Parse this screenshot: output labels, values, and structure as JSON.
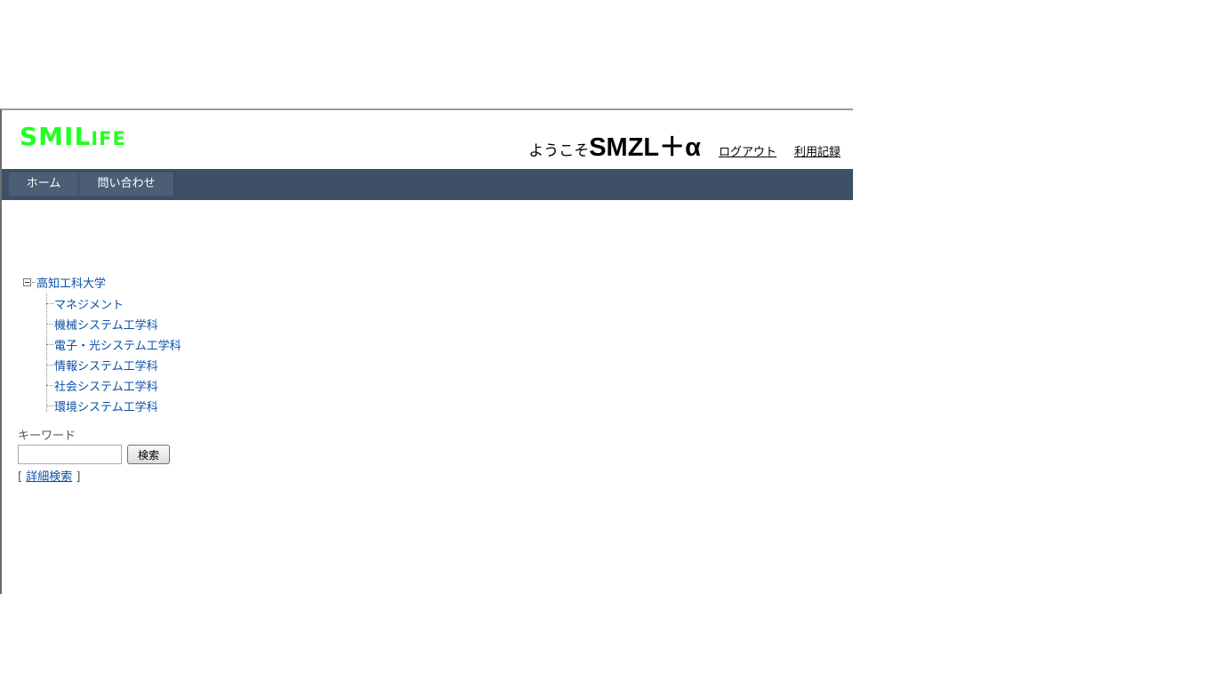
{
  "header": {
    "logo_main": "SMIL",
    "logo_small": "IFE",
    "welcome": "ようこそ",
    "username": "SMZL＋α",
    "logout": "ログアウト",
    "usage_history": "利用記録"
  },
  "nav": {
    "home": "ホーム",
    "contact": "問い合わせ"
  },
  "tree": {
    "root": "高知工科大学",
    "children": [
      "マネジメント",
      "機械システム工学科",
      "電子・光システム工学科",
      "情報システム工学科",
      "社会システム工学科",
      "環境システム工学科"
    ]
  },
  "search": {
    "label": "キーワード",
    "value": "",
    "button": "検索",
    "bracket_open": "[",
    "advanced": "詳細検索",
    "bracket_close": "]"
  }
}
